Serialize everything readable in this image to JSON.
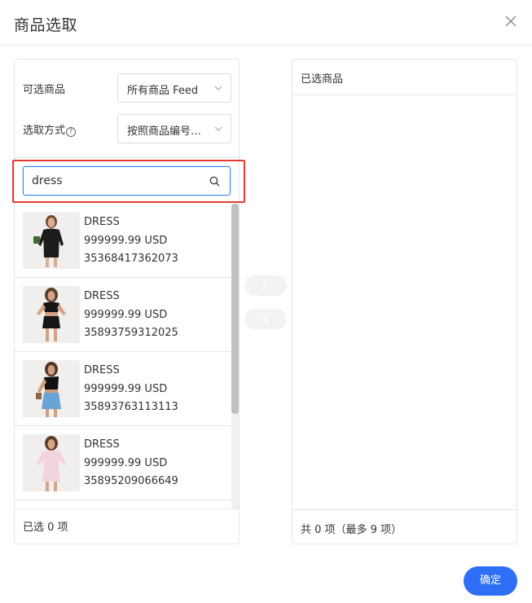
{
  "dialog": {
    "title": "商品选取",
    "close_icon": "close-icon"
  },
  "left_panel": {
    "source_label": "可选商品",
    "source_value": "所有商品 Feed",
    "method_label": "选取方式",
    "help_icon_glyph": "?",
    "method_value": "按照商品编号…",
    "search": {
      "value": "dress",
      "placeholder": ""
    },
    "items": [
      {
        "name": "DRESS",
        "price": "999999.99 USD",
        "id": "35368417362073",
        "top_color": "#1c1c1c",
        "bottom_color": "#1c1c1c"
      },
      {
        "name": "DRESS",
        "price": "999999.99 USD",
        "id": "35893759312025",
        "top_color": "#161616",
        "bottom_color": "#161616"
      },
      {
        "name": "DRESS",
        "price": "999999.99 USD",
        "id": "35893763113113",
        "top_color": "#111111",
        "bottom_color": "#6aa3d6"
      },
      {
        "name": "DRESS",
        "price": "999999.99 USD",
        "id": "35895209066649",
        "top_color": "#f2d4dc",
        "bottom_color": "#f2d4dc"
      }
    ],
    "footer": "已选 0 项"
  },
  "transfer": {
    "right_icon": "chevron-right-icon",
    "left_icon": "chevron-left-icon"
  },
  "right_panel": {
    "header": "已选商品",
    "footer": "共 0 项（最多 9 项）"
  },
  "actions": {
    "confirm_label": "确定"
  },
  "colors": {
    "primary": "#2f6ff5",
    "highlight": "#e53935",
    "focus": "#3b82f6"
  }
}
